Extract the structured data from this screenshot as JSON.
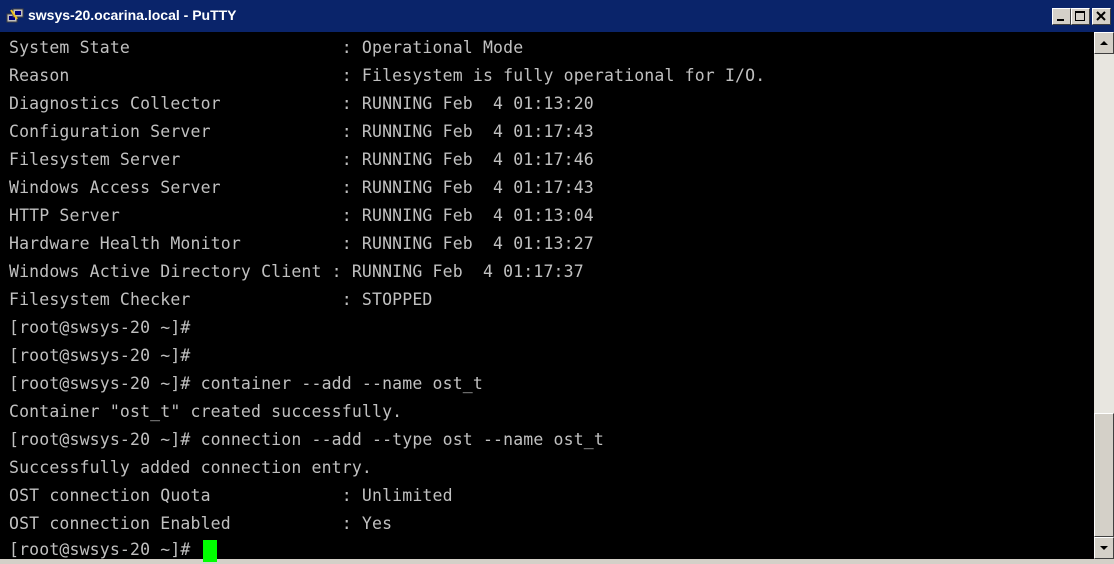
{
  "window": {
    "title": "swsys-20.ocarina.local - PuTTY",
    "icons": {
      "app": "putty-icon",
      "minimize": "minimize-icon",
      "maximize": "maximize-icon",
      "close": "close-icon"
    },
    "colors": {
      "titlebar": "#0a246a",
      "terminal_bg": "#000000",
      "terminal_fg": "#c0c0c0",
      "cursor": "#00ff00"
    }
  },
  "terminal": {
    "lines": [
      "System State                     : Operational Mode",
      "Reason                           : Filesystem is fully operational for I/O.",
      "Diagnostics Collector            : RUNNING Feb  4 01:13:20",
      "Configuration Server             : RUNNING Feb  4 01:17:43",
      "Filesystem Server                : RUNNING Feb  4 01:17:46",
      "Windows Access Server            : RUNNING Feb  4 01:17:43",
      "HTTP Server                      : RUNNING Feb  4 01:13:04",
      "Hardware Health Monitor          : RUNNING Feb  4 01:13:27",
      "Windows Active Directory Client : RUNNING Feb  4 01:17:37",
      "Filesystem Checker               : STOPPED",
      "[root@swsys-20 ~]#",
      "[root@swsys-20 ~]#",
      "[root@swsys-20 ~]# container --add --name ost_t",
      "Container \"ost_t\" created successfully.",
      "[root@swsys-20 ~]# connection --add --type ost --name ost_t",
      "Successfully added connection entry.",
      "OST connection Quota             : Unlimited",
      "OST connection Enabled           : Yes"
    ],
    "prompt": "[root@swsys-20 ~]# "
  }
}
